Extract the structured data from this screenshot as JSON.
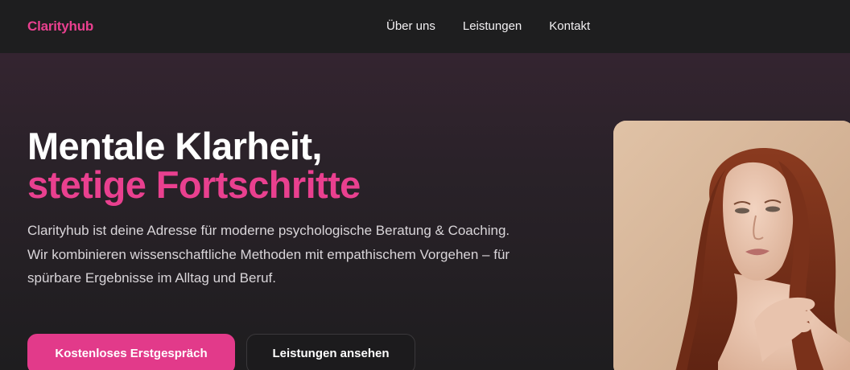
{
  "header": {
    "brand": "Clarityhub",
    "nav": [
      "Über uns",
      "Leistungen",
      "Kontakt"
    ]
  },
  "hero": {
    "headline_line1": "Mentale Klarheit,",
    "headline_line2": "stetige Fortschritte",
    "description": "Clarityhub ist deine Adresse für moderne psychologische Beratung & Coaching. Wir kombinieren wissenschaftliche Methoden mit empathischem Vorgehen – für spürbare Ergebnisse im Alltag und Beruf.",
    "primary_button": "Kostenloses Erstgespräch",
    "secondary_button": "Leistungen ansehen"
  },
  "colors": {
    "accent": "#e9408f",
    "background": "#1d1c1e",
    "text": "#ffffff"
  },
  "image": {
    "subject": "portrait-photo"
  }
}
